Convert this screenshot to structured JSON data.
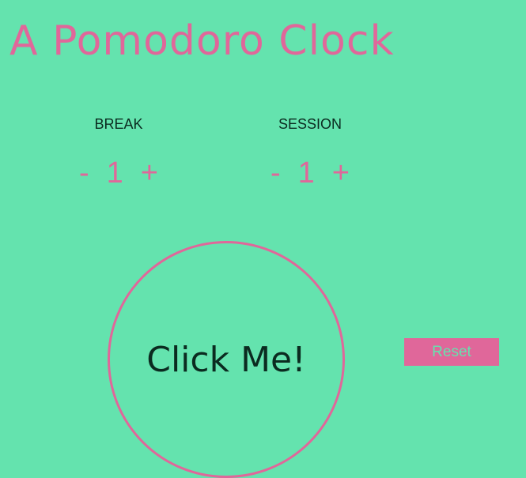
{
  "app": {
    "title": "A Pomodoro Clock"
  },
  "break": {
    "label": "BREAK",
    "decrement": "-",
    "value": "1",
    "increment": "+"
  },
  "session": {
    "label": "SESSION",
    "decrement": "-",
    "value": "1",
    "increment": "+"
  },
  "clock": {
    "label": "Click Me!"
  },
  "reset": {
    "label": "Reset"
  },
  "colors": {
    "background": "#64e3ae",
    "accent": "#e0679a",
    "text": "#0b2b20"
  }
}
